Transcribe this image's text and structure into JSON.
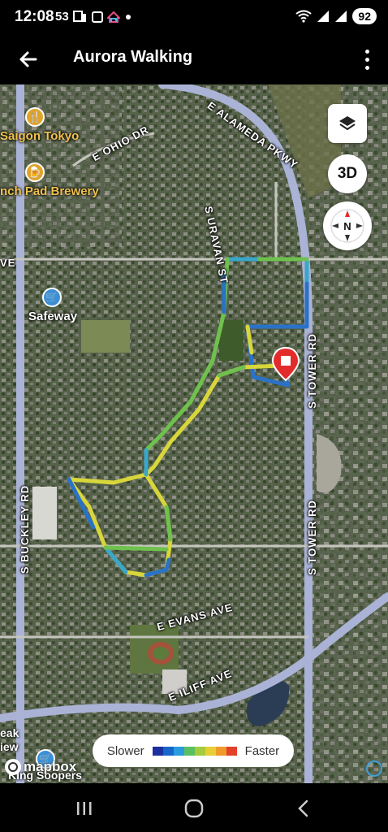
{
  "status_bar": {
    "time": "12:08",
    "temp": "53",
    "battery": "92",
    "icons": [
      "notification-p-icon",
      "notification-tile-icon",
      "home-icon",
      "dot-icon",
      "wifi-icon",
      "signal-icon",
      "signal-icon"
    ]
  },
  "app_bar": {
    "title": "Aurora Walking",
    "back_icon": "arrow-left-icon",
    "menu_icon": "more-vert-icon"
  },
  "map": {
    "streets": {
      "e_alameda": "E ALAMEDA PKWY",
      "e_ohio": "E OHIO DR",
      "s_uravan": "S URAVAN ST",
      "s_tower_top": "S TOWER RD",
      "s_tower_bottom": "S TOWER RD",
      "s_buckley": "S BUCKLEY RD",
      "e_evans": "E EVANS AVE",
      "e_iliff": "E ILIFF AVE",
      "ave_left": "VE"
    },
    "pois": {
      "saigon": "Saigon Tokyo",
      "brewery": "nch Pad Brewery",
      "safeway": "Safeway",
      "king_soopers": "King Soopers",
      "peak_line1": "eak",
      "peak_line2": "iew"
    },
    "controls": {
      "layers_icon": "layers-icon",
      "three_d_label": "3D",
      "compass_letter": "N",
      "compass_icon": "compass-icon"
    },
    "legend": {
      "slower": "Slower",
      "faster": "Faster",
      "colors": [
        "#1b2f9e",
        "#1667c9",
        "#2b9be0",
        "#5bbf60",
        "#a4cc3c",
        "#e8cd35",
        "#f09a2b",
        "#e4412a"
      ]
    },
    "attribution": "mapbox",
    "route_colors": {
      "blue": "#2a72c8",
      "teal": "#38a7c9",
      "green": "#6fc14d",
      "yellow": "#d8d63a",
      "end_marker": "#e32b2b",
      "start_marker": "#2bbd45"
    }
  },
  "nav_bar": {
    "recents_icon": "recents-icon",
    "home_icon": "home-circle-icon",
    "back_icon": "nav-back-icon"
  }
}
